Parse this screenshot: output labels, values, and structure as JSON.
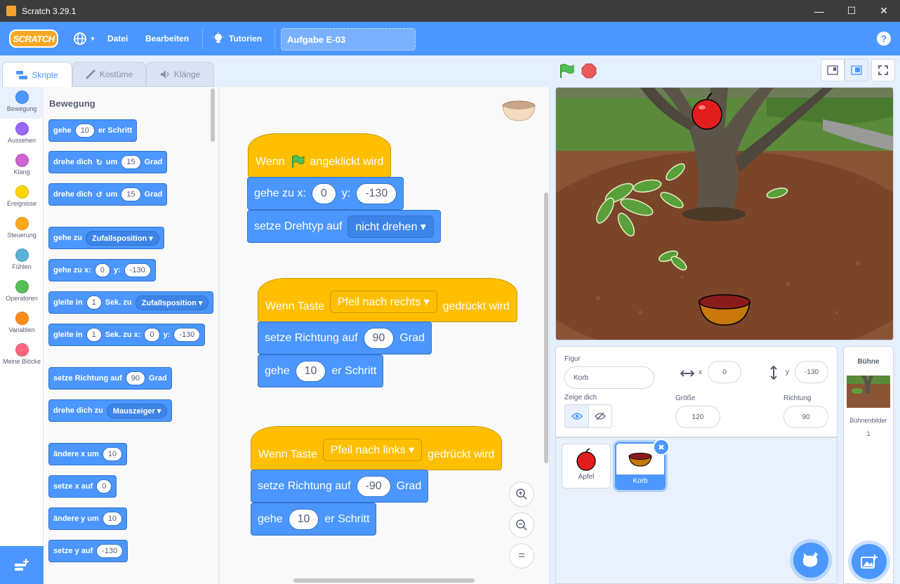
{
  "window": {
    "title": "Scratch 3.29.1"
  },
  "menu": {
    "logo": "SCRATCH",
    "file": "Datei",
    "edit": "Bearbeiten",
    "tutorials": "Tutorien",
    "project_title": "Aufgabe E-03"
  },
  "tabs": {
    "code": "Skripte",
    "costumes": "Kostüme",
    "sounds": "Klänge"
  },
  "categories": [
    {
      "label": "Bewegung",
      "color": "#4c97ff"
    },
    {
      "label": "Aussehen",
      "color": "#9966ff"
    },
    {
      "label": "Klang",
      "color": "#cf63cf"
    },
    {
      "label": "Ereignisse",
      "color": "#ffd500"
    },
    {
      "label": "Steuerung",
      "color": "#ffab19"
    },
    {
      "label": "Fühlen",
      "color": "#5cb1d6"
    },
    {
      "label": "Operatoren",
      "color": "#59c059"
    },
    {
      "label": "Variablen",
      "color": "#ff8c1a"
    },
    {
      "label": "Meine Blöcke",
      "color": "#ff6680"
    }
  ],
  "palette": {
    "heading": "Bewegung",
    "b1": {
      "a": "gehe",
      "v": "10",
      "b": "er Schritt"
    },
    "b2": {
      "a": "drehe dich",
      "b": "um",
      "v": "15",
      "c": "Grad"
    },
    "b3": {
      "a": "drehe dich",
      "b": "um",
      "v": "15",
      "c": "Grad"
    },
    "b4": {
      "a": "gehe zu",
      "d": "Zufallsposition"
    },
    "b5": {
      "a": "gehe zu x:",
      "v1": "0",
      "b": "y:",
      "v2": "-130"
    },
    "b6": {
      "a": "gleite in",
      "v": "1",
      "b": "Sek. zu",
      "d": "Zufallsposition"
    },
    "b7": {
      "a": "gleite in",
      "v1": "1",
      "b": "Sek. zu x:",
      "v2": "0",
      "c": "y:",
      "v3": "-130"
    },
    "b8": {
      "a": "setze Richtung auf",
      "v": "90",
      "b": "Grad"
    },
    "b9": {
      "a": "drehe dich zu",
      "d": "Mauszeiger"
    },
    "b10": {
      "a": "ändere x um",
      "v": "10"
    },
    "b11": {
      "a": "setze x auf",
      "v": "0"
    },
    "b12": {
      "a": "ändere y um",
      "v": "10"
    },
    "b13": {
      "a": "setze y auf",
      "v": "-130"
    }
  },
  "scripts": {
    "s1": {
      "hat_a": "Wenn",
      "hat_b": "angeklickt wird",
      "goto_a": "gehe zu x:",
      "goto_x": "0",
      "goto_b": "y:",
      "goto_y": "-130",
      "rot_a": "setze Drehtyp auf",
      "rot_d": "nicht drehen"
    },
    "s2": {
      "hat_a": "Wenn Taste",
      "hat_d": "Pfeil nach rechts",
      "hat_b": "gedrückt wird",
      "dir_a": "setze Richtung auf",
      "dir_v": "90",
      "dir_b": "Grad",
      "move_a": "gehe",
      "move_v": "10",
      "move_b": "er Schritt"
    },
    "s3": {
      "hat_a": "Wenn Taste",
      "hat_d": "Pfeil nach links",
      "hat_b": "gedrückt wird",
      "dir_a": "setze Richtung auf",
      "dir_v": "-90",
      "dir_b": "Grad",
      "move_a": "gehe",
      "move_v": "10",
      "move_b": "er Schritt"
    },
    "zoom_reset": "="
  },
  "sprite_info": {
    "label_sprite": "Figur",
    "name": "Korb",
    "label_x": "x",
    "x": "0",
    "label_y": "y",
    "y": "-130",
    "label_show": "Zeige dich",
    "label_size": "Größe",
    "size": "120",
    "label_dir": "Richtung",
    "direction": "90"
  },
  "sprites": [
    {
      "name": "Apfel"
    },
    {
      "name": "Korb"
    }
  ],
  "stage_panel": {
    "title": "Bühne",
    "backdrops_label": "Bühnenbilder",
    "backdrops_count": "1"
  }
}
